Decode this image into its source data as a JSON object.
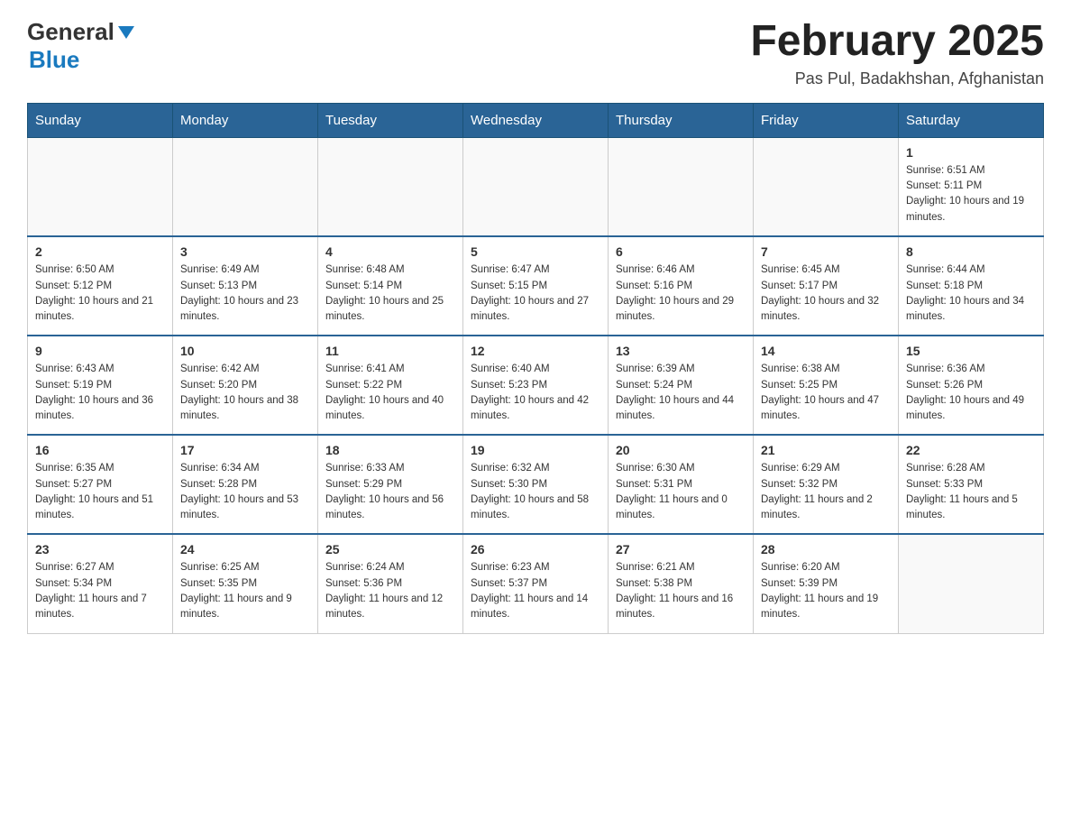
{
  "header": {
    "logo_general": "General",
    "logo_blue": "Blue",
    "month_title": "February 2025",
    "location": "Pas Pul, Badakhshan, Afghanistan"
  },
  "weekdays": [
    "Sunday",
    "Monday",
    "Tuesday",
    "Wednesday",
    "Thursday",
    "Friday",
    "Saturday"
  ],
  "weeks": [
    [
      {
        "day": "",
        "info": ""
      },
      {
        "day": "",
        "info": ""
      },
      {
        "day": "",
        "info": ""
      },
      {
        "day": "",
        "info": ""
      },
      {
        "day": "",
        "info": ""
      },
      {
        "day": "",
        "info": ""
      },
      {
        "day": "1",
        "info": "Sunrise: 6:51 AM\nSunset: 5:11 PM\nDaylight: 10 hours and 19 minutes."
      }
    ],
    [
      {
        "day": "2",
        "info": "Sunrise: 6:50 AM\nSunset: 5:12 PM\nDaylight: 10 hours and 21 minutes."
      },
      {
        "day": "3",
        "info": "Sunrise: 6:49 AM\nSunset: 5:13 PM\nDaylight: 10 hours and 23 minutes."
      },
      {
        "day": "4",
        "info": "Sunrise: 6:48 AM\nSunset: 5:14 PM\nDaylight: 10 hours and 25 minutes."
      },
      {
        "day": "5",
        "info": "Sunrise: 6:47 AM\nSunset: 5:15 PM\nDaylight: 10 hours and 27 minutes."
      },
      {
        "day": "6",
        "info": "Sunrise: 6:46 AM\nSunset: 5:16 PM\nDaylight: 10 hours and 29 minutes."
      },
      {
        "day": "7",
        "info": "Sunrise: 6:45 AM\nSunset: 5:17 PM\nDaylight: 10 hours and 32 minutes."
      },
      {
        "day": "8",
        "info": "Sunrise: 6:44 AM\nSunset: 5:18 PM\nDaylight: 10 hours and 34 minutes."
      }
    ],
    [
      {
        "day": "9",
        "info": "Sunrise: 6:43 AM\nSunset: 5:19 PM\nDaylight: 10 hours and 36 minutes."
      },
      {
        "day": "10",
        "info": "Sunrise: 6:42 AM\nSunset: 5:20 PM\nDaylight: 10 hours and 38 minutes."
      },
      {
        "day": "11",
        "info": "Sunrise: 6:41 AM\nSunset: 5:22 PM\nDaylight: 10 hours and 40 minutes."
      },
      {
        "day": "12",
        "info": "Sunrise: 6:40 AM\nSunset: 5:23 PM\nDaylight: 10 hours and 42 minutes."
      },
      {
        "day": "13",
        "info": "Sunrise: 6:39 AM\nSunset: 5:24 PM\nDaylight: 10 hours and 44 minutes."
      },
      {
        "day": "14",
        "info": "Sunrise: 6:38 AM\nSunset: 5:25 PM\nDaylight: 10 hours and 47 minutes."
      },
      {
        "day": "15",
        "info": "Sunrise: 6:36 AM\nSunset: 5:26 PM\nDaylight: 10 hours and 49 minutes."
      }
    ],
    [
      {
        "day": "16",
        "info": "Sunrise: 6:35 AM\nSunset: 5:27 PM\nDaylight: 10 hours and 51 minutes."
      },
      {
        "day": "17",
        "info": "Sunrise: 6:34 AM\nSunset: 5:28 PM\nDaylight: 10 hours and 53 minutes."
      },
      {
        "day": "18",
        "info": "Sunrise: 6:33 AM\nSunset: 5:29 PM\nDaylight: 10 hours and 56 minutes."
      },
      {
        "day": "19",
        "info": "Sunrise: 6:32 AM\nSunset: 5:30 PM\nDaylight: 10 hours and 58 minutes."
      },
      {
        "day": "20",
        "info": "Sunrise: 6:30 AM\nSunset: 5:31 PM\nDaylight: 11 hours and 0 minutes."
      },
      {
        "day": "21",
        "info": "Sunrise: 6:29 AM\nSunset: 5:32 PM\nDaylight: 11 hours and 2 minutes."
      },
      {
        "day": "22",
        "info": "Sunrise: 6:28 AM\nSunset: 5:33 PM\nDaylight: 11 hours and 5 minutes."
      }
    ],
    [
      {
        "day": "23",
        "info": "Sunrise: 6:27 AM\nSunset: 5:34 PM\nDaylight: 11 hours and 7 minutes."
      },
      {
        "day": "24",
        "info": "Sunrise: 6:25 AM\nSunset: 5:35 PM\nDaylight: 11 hours and 9 minutes."
      },
      {
        "day": "25",
        "info": "Sunrise: 6:24 AM\nSunset: 5:36 PM\nDaylight: 11 hours and 12 minutes."
      },
      {
        "day": "26",
        "info": "Sunrise: 6:23 AM\nSunset: 5:37 PM\nDaylight: 11 hours and 14 minutes."
      },
      {
        "day": "27",
        "info": "Sunrise: 6:21 AM\nSunset: 5:38 PM\nDaylight: 11 hours and 16 minutes."
      },
      {
        "day": "28",
        "info": "Sunrise: 6:20 AM\nSunset: 5:39 PM\nDaylight: 11 hours and 19 minutes."
      },
      {
        "day": "",
        "info": ""
      }
    ]
  ]
}
